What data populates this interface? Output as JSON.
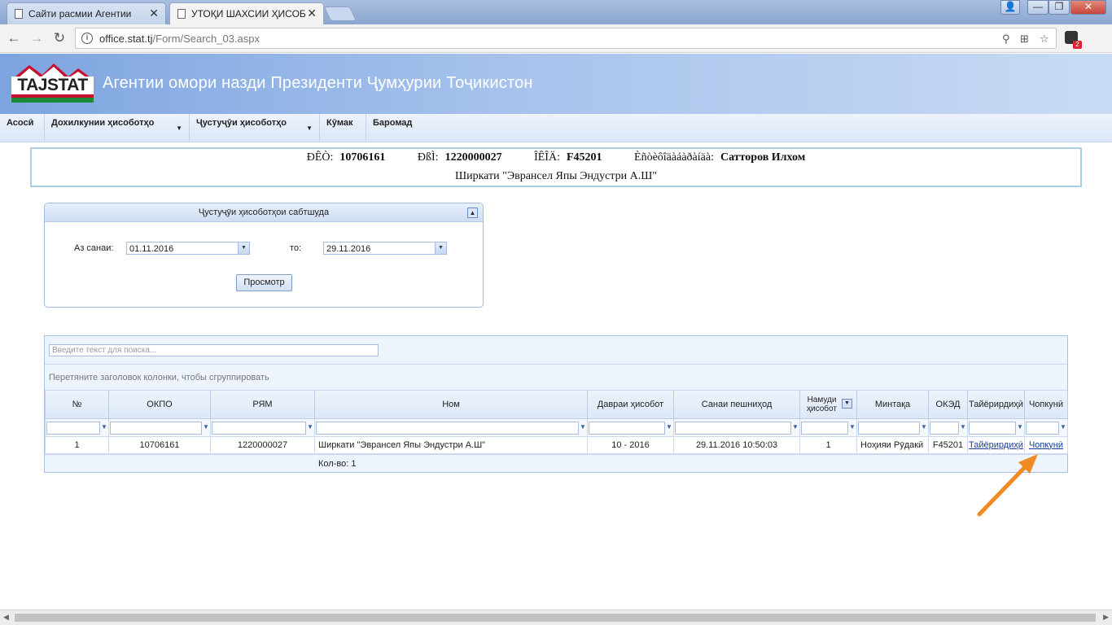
{
  "browser": {
    "tabs": [
      {
        "title": "Сайти расмии Агентии"
      },
      {
        "title": "УТОҚИ ШАХСИИ ҲИСОБОТ"
      }
    ],
    "url_host": "office.stat.tj",
    "url_path": "/Form/Search_03.aspx",
    "extension_badge": "2",
    "icons": [
      "back-icon",
      "forward-icon",
      "reload-icon",
      "info-icon",
      "zoom-icon",
      "translate-icon",
      "star-icon",
      "menu-icon"
    ]
  },
  "site": {
    "logo_text": "TAJSTAT",
    "title": "Агентии омори назди Президенти Ҷумҳурии Тоҷикистон",
    "colors": {
      "header": "#7da4e0",
      "logo_red": "#c8102e",
      "logo_green": "#1a8a3a"
    }
  },
  "menu": [
    {
      "label": "Асосӣ"
    },
    {
      "label": "Дохилкунии ҳисоботҳо"
    },
    {
      "label": "Ҷустуҷӯи ҳисоботҳо"
    },
    {
      "label": "Кӯмак"
    },
    {
      "label": "Баромад"
    }
  ],
  "info": {
    "label1": "ÐÊÒ:",
    "value1": "10706161",
    "label2": "ÐßÌ:",
    "value2": "1220000027",
    "label3": "ÎÊÎÄ:",
    "value3": "F45201",
    "label4": "Èñòèôîäàáàðàíäà:",
    "value4": "Сатторов Илхом",
    "company": "Ширкати \"Эврансел Япы Эндустри А.Ш\""
  },
  "filter": {
    "title": "Ҷустуҷӯи ҳисоботҳои сабтшуда",
    "from_label": "Аз санаи:",
    "from_value": "01.11.2016",
    "to_label": "то:",
    "to_value": "29.11.2016",
    "view_button": "Просмотр"
  },
  "grid": {
    "search_placeholder": "Введите текст для поиска...",
    "group_hint": "Перетяните заголовок колонки, чтобы сгруппировать",
    "columns": [
      "№",
      "ОКПО",
      "РЯМ",
      "Ном",
      "Давраи ҳисобот",
      "Санаи пешниҳод",
      "Намуди ҳисобот",
      "Минтақа",
      "ОКЭД",
      "Тайёрирдиҳӣ",
      "Чопкунӣ"
    ],
    "rows": [
      {
        "num": "1",
        "okpo": "10706161",
        "ryam": "1220000027",
        "name": "Ширкати \"Эврансел Япы Эндустри А.Ш\"",
        "period": "10 - 2016",
        "date": "29.11.2016 10:50:03",
        "type": "1",
        "region": "Ноҳияи Рӯдакӣ",
        "oked": "F45201",
        "prepare": "Тайёрирдиҳӣ",
        "print": "Чопкунӣ"
      }
    ],
    "count": "Кол-во: 1"
  },
  "annotation": {
    "arrow_color": "#f08a24"
  }
}
